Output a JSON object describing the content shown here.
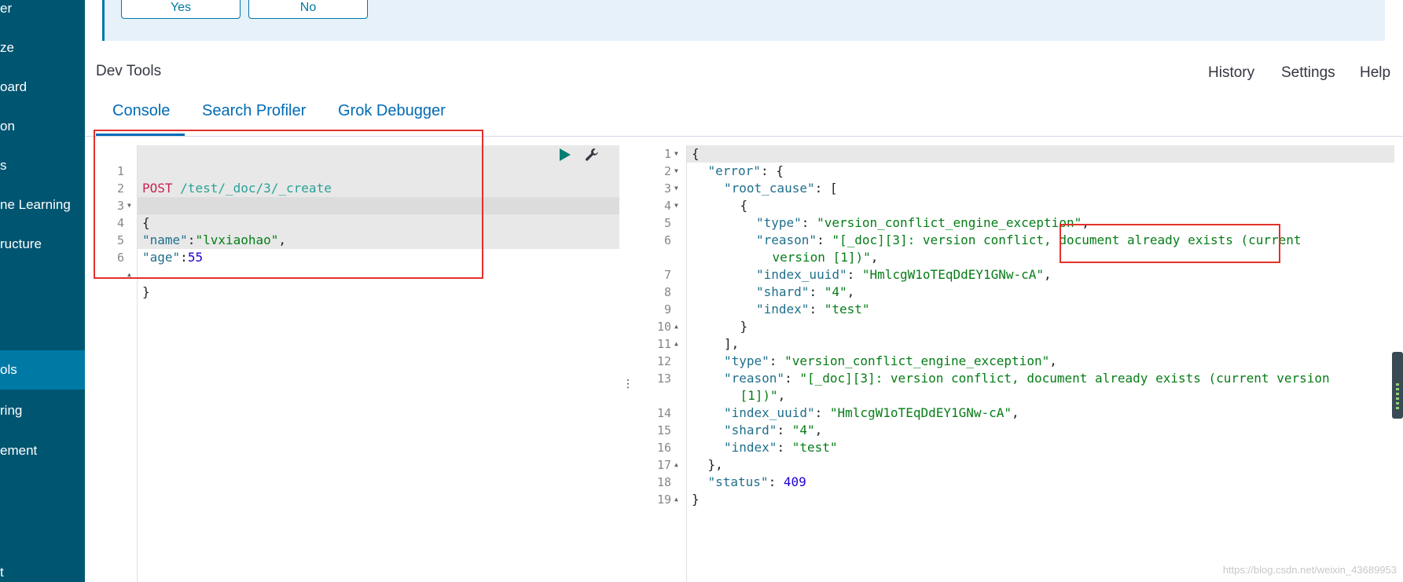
{
  "sidenav": {
    "items": [
      {
        "label": "er",
        "active": false
      },
      {
        "label": "ze",
        "active": false
      },
      {
        "label": "oard",
        "active": false
      },
      {
        "label": "on",
        "active": false
      },
      {
        "label": "s",
        "active": false
      },
      {
        "label": "ne Learning",
        "active": false
      },
      {
        "label": "ructure",
        "active": false
      },
      {
        "label": "ols",
        "active": true
      },
      {
        "label": "ring",
        "active": false
      },
      {
        "label": "ement",
        "active": false
      },
      {
        "label": "t",
        "active": false
      }
    ]
  },
  "callout": {
    "yes_label": "Yes",
    "no_label": "No"
  },
  "header": {
    "title": "Dev Tools",
    "links": {
      "history": "History",
      "settings": "Settings",
      "help": "Help"
    }
  },
  "tabs": [
    {
      "label": "Console",
      "active": true
    },
    {
      "label": "Search Profiler",
      "active": false
    },
    {
      "label": "Grok Debugger",
      "active": false
    }
  ],
  "request": {
    "lines": [
      {
        "num": "1",
        "text": ""
      },
      {
        "num": "2",
        "text": "{"
      },
      {
        "num": "3",
        "text": ""
      },
      {
        "num": "4",
        "text": ""
      },
      {
        "num": "5",
        "text": ""
      },
      {
        "num": "6",
        "text": "}"
      }
    ],
    "method": "POST",
    "url": "/test/_doc/3/_create",
    "name_key": "\"name\"",
    "name_sep": ":",
    "name_value": "\"lvxiaohao\"",
    "name_comma": ",",
    "age_key": "\"age\"",
    "age_sep": ":",
    "age_value": "55"
  },
  "response": {
    "lines": [
      {
        "num": "1"
      },
      {
        "num": "2"
      },
      {
        "num": "3"
      },
      {
        "num": "4"
      },
      {
        "num": "5"
      },
      {
        "num": "6"
      },
      {
        "num": "7"
      },
      {
        "num": "8"
      },
      {
        "num": "9"
      },
      {
        "num": "10"
      },
      {
        "num": "11"
      },
      {
        "num": "12"
      },
      {
        "num": "13"
      },
      {
        "num": "14"
      },
      {
        "num": "15"
      },
      {
        "num": "16"
      },
      {
        "num": "17"
      },
      {
        "num": "18"
      },
      {
        "num": "19"
      }
    ],
    "error_key": "\"error\"",
    "root_cause_key": "\"root_cause\"",
    "type_key": "\"type\"",
    "reason_key": "\"reason\"",
    "index_uuid_key": "\"index_uuid\"",
    "shard_key": "\"shard\"",
    "index_key": "\"index\"",
    "status_key": "\"status\"",
    "type_value": "\"version_conflict_engine_exception\"",
    "reason_value_a": "\"[_doc][3]: version conflict, document already exists (current",
    "reason_value_b": "version [1])\"",
    "reason_value_top_a": "\"[_doc][3]: version conflict, document already exists (current version",
    "reason_value_top_b": "[1])\"",
    "index_uuid_value": "\"HmlcgW1oTEqDdEY1GNw-cA\"",
    "shard_value": "\"4\"",
    "index_value": "\"test\"",
    "status_value": "409"
  },
  "watermark": "https://blog.csdn.net/weixin_43689953"
}
